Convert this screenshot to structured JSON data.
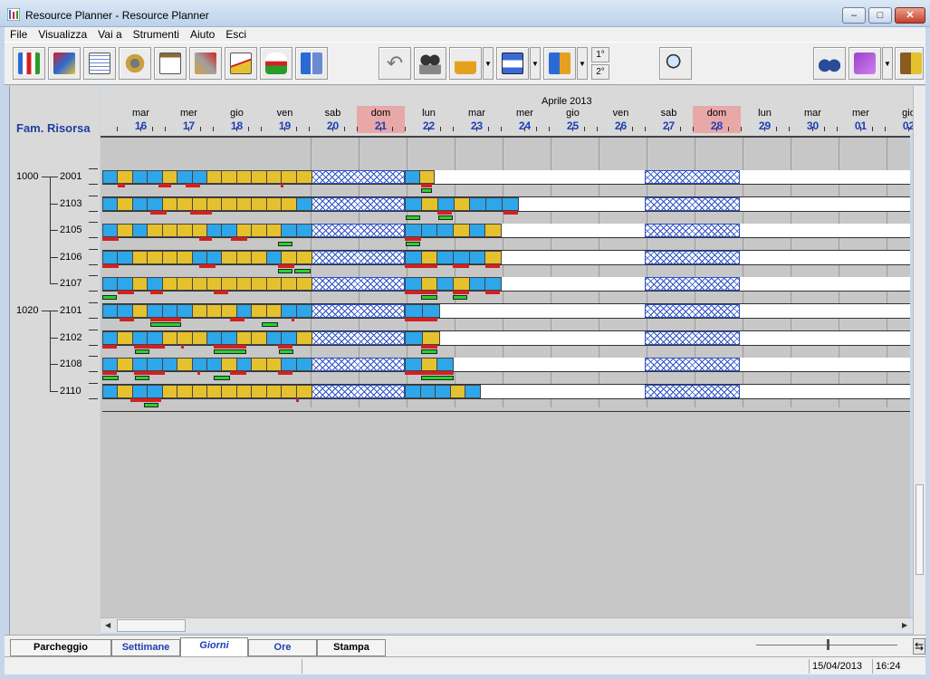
{
  "window": {
    "title": "Resource Planner - Resource Planner",
    "min": "–",
    "max": "□",
    "close": "✕"
  },
  "menu": [
    "File",
    "Visualizza",
    "Vai a",
    "Strumenti",
    "Aiuto",
    "Esci"
  ],
  "toolbar": {
    "icons": [
      "chart-bars-icon",
      "resources-icon",
      "calendar-edit-icon",
      "gears-icon",
      "clipboard-icon",
      "tools-icon",
      "line-chart-icon",
      "lab-flask-icon",
      "network-icon",
      "undo-icon",
      "projector-icon",
      "lock-icon",
      "save-icon",
      "transfer-icon",
      "magnifier-icon",
      "binoculars-icon",
      "help-book-icon",
      "exit-door-icon"
    ],
    "shift1": "1°",
    "shift2": "2°"
  },
  "header": {
    "family_label": "Fam. Risorsa",
    "month": "Aprile 2013",
    "days": [
      {
        "name": "mar",
        "num": "16"
      },
      {
        "name": "mer",
        "num": "17"
      },
      {
        "name": "gio",
        "num": "18"
      },
      {
        "name": "ven",
        "num": "19"
      },
      {
        "name": "sab",
        "num": "20"
      },
      {
        "name": "dom",
        "num": "21",
        "sunday": true
      },
      {
        "name": "lun",
        "num": "22"
      },
      {
        "name": "mar",
        "num": "23"
      },
      {
        "name": "mer",
        "num": "24"
      },
      {
        "name": "gio",
        "num": "25"
      },
      {
        "name": "ven",
        "num": "26"
      },
      {
        "name": "sab",
        "num": "27"
      },
      {
        "name": "dom",
        "num": "28",
        "sunday": true
      },
      {
        "name": "lun",
        "num": "29"
      },
      {
        "name": "mar",
        "num": "30"
      },
      {
        "name": "mer",
        "num": "01"
      },
      {
        "name": "gio",
        "num": "02"
      }
    ]
  },
  "families": [
    {
      "code": "1000",
      "resources": [
        "2001",
        "2103",
        "2105",
        "2106",
        "2107"
      ]
    },
    {
      "code": "1020",
      "resources": [
        "2101",
        "2102",
        "2108",
        "2110"
      ]
    }
  ],
  "tabs": [
    "Parcheggio",
    "Settimane",
    "Giorni",
    "Ore",
    "Stampa"
  ],
  "active_tab": "Giorni",
  "status": {
    "date": "15/04/2013",
    "time": "16:24"
  },
  "colors": {
    "task_yellow": "#e6c12e",
    "task_blue": "#2ea6ea",
    "mark_red": "#d42020",
    "mark_green": "#27d32b",
    "weekend_hatch": "#2b4fc4",
    "sunday_header": "#e8a8a8"
  }
}
